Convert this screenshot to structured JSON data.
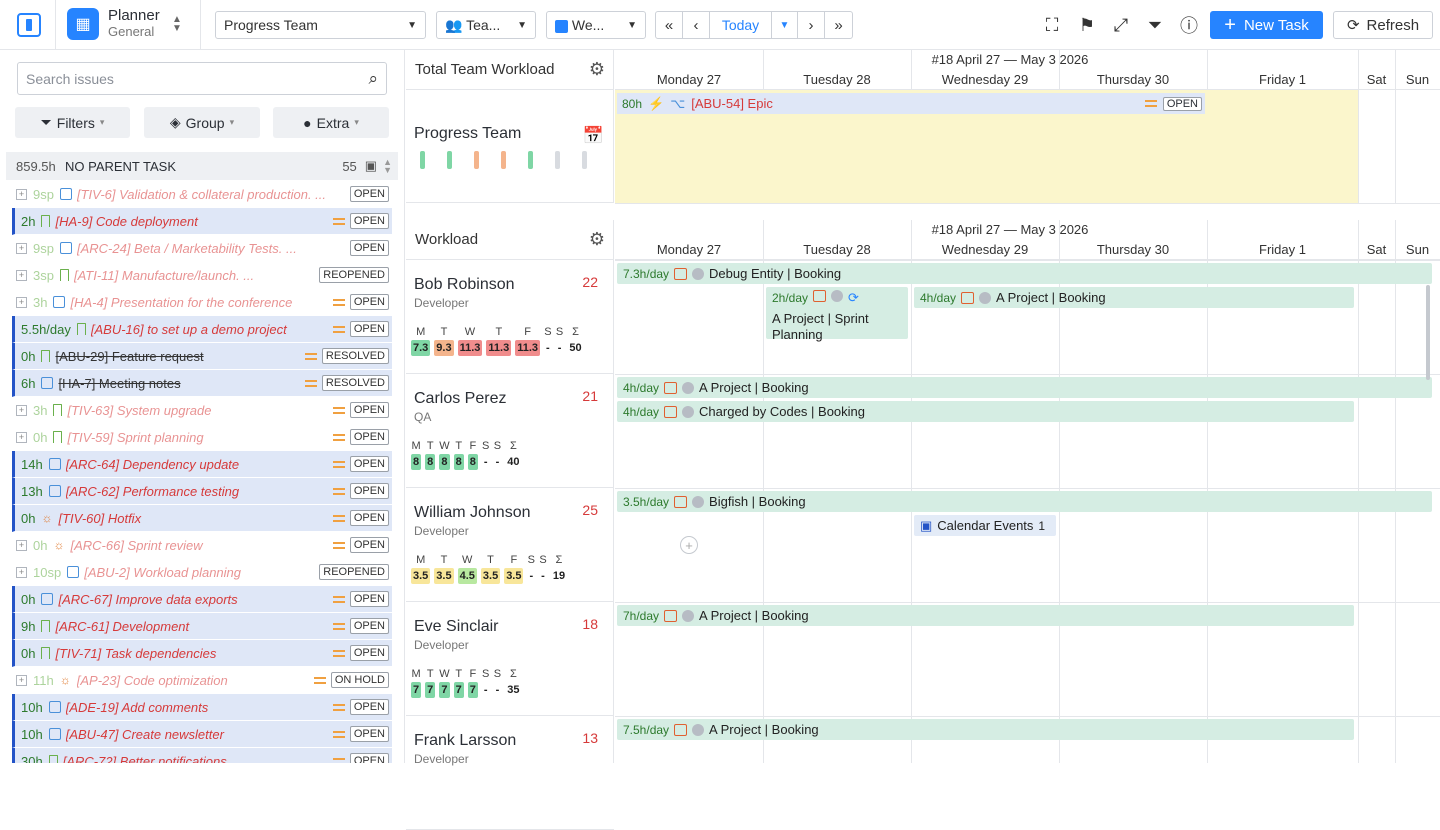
{
  "app": {
    "title": "Planner",
    "subtitle": "General"
  },
  "toolbar": {
    "team_select": "Progress Team",
    "group_select": "Tea...",
    "view_select": "We...",
    "today": "Today",
    "new_task": "New Task",
    "refresh": "Refresh"
  },
  "left": {
    "search_placeholder": "Search issues",
    "filters": "Filters",
    "group": "Group",
    "extra": "Extra",
    "group_header": {
      "hours": "859.5h",
      "label": "NO PARENT TASK",
      "count": "55"
    },
    "rows": [
      {
        "est": "9sp",
        "icon": "check",
        "name": "[TIV-6] Validation & collateral production. ...",
        "status": "OPEN",
        "style": "plain",
        "faded": true,
        "eq": false
      },
      {
        "est": "2h",
        "icon": "bookmark",
        "name": "[HA-9] Code deployment",
        "status": "OPEN",
        "style": "blue",
        "faded": false,
        "eq": true
      },
      {
        "est": "9sp",
        "icon": "check",
        "name": "[ARC-24] Beta / Marketability Tests. ...",
        "status": "OPEN",
        "style": "plain",
        "faded": true,
        "eq": false
      },
      {
        "est": "3sp",
        "icon": "bookmark",
        "name": "[ATI-11] Manufacture/launch. ...",
        "status": "REOPENED",
        "style": "plain",
        "faded": true,
        "eq": false
      },
      {
        "est": "3h",
        "icon": "check",
        "name": "[HA-4] Presentation for the conference",
        "status": "OPEN",
        "style": "plain",
        "faded": true,
        "eq": true
      },
      {
        "est": "5.5h/day",
        "icon": "bookmark",
        "name": "[ABU-16] to set up a demo project",
        "status": "OPEN",
        "style": "blue",
        "faded": false,
        "eq": true
      },
      {
        "est": "0h",
        "icon": "bookmark",
        "name": "[ABU-29] Feature request",
        "status": "RESOLVED",
        "style": "blue",
        "faded": false,
        "eq": true,
        "done": true
      },
      {
        "est": "6h",
        "icon": "check",
        "name": "[HA-7] Meeting notes",
        "status": "RESOLVED",
        "style": "blue",
        "faded": false,
        "eq": true,
        "done": true
      },
      {
        "est": "3h",
        "icon": "bookmark",
        "name": "[TIV-63] System upgrade",
        "status": "OPEN",
        "style": "plain",
        "faded": true,
        "eq": true
      },
      {
        "est": "0h",
        "icon": "bookmark",
        "name": "[TIV-59] Sprint planning",
        "status": "OPEN",
        "style": "plain",
        "faded": true,
        "eq": true
      },
      {
        "est": "14h",
        "icon": "check",
        "name": "[ARC-64] Dependency update",
        "status": "OPEN",
        "style": "blue",
        "faded": false,
        "eq": true
      },
      {
        "est": "13h",
        "icon": "check",
        "name": "[ARC-62] Performance testing",
        "status": "OPEN",
        "style": "blue",
        "faded": false,
        "eq": true
      },
      {
        "est": "0h",
        "icon": "bug",
        "name": "[TIV-60] Hotfix",
        "status": "OPEN",
        "style": "blue",
        "faded": false,
        "eq": true
      },
      {
        "est": "0h",
        "icon": "bug",
        "name": "[ARC-66] Sprint review",
        "status": "OPEN",
        "style": "plain",
        "faded": true,
        "eq": true
      },
      {
        "est": "10sp",
        "icon": "check",
        "name": "[ABU-2] Workload planning",
        "status": "REOPENED",
        "style": "plain",
        "faded": true,
        "eq": false
      },
      {
        "est": "0h",
        "icon": "check",
        "name": "[ARC-67] Improve data exports",
        "status": "OPEN",
        "style": "blue",
        "faded": false,
        "eq": true
      },
      {
        "est": "9h",
        "icon": "bookmark",
        "name": "[ARC-61] Development",
        "status": "OPEN",
        "style": "blue",
        "faded": false,
        "eq": true
      },
      {
        "est": "0h",
        "icon": "bookmark",
        "name": "[TIV-71] Task dependencies",
        "status": "OPEN",
        "style": "blue",
        "faded": false,
        "eq": true
      },
      {
        "est": "11h",
        "icon": "bug",
        "name": "[AP-23] Code optimization",
        "status": "ON HOLD",
        "style": "plain",
        "faded": true,
        "eq": true
      },
      {
        "est": "10h",
        "icon": "check",
        "name": "[ADE-19] Add comments",
        "status": "OPEN",
        "style": "blue",
        "faded": false,
        "eq": true
      },
      {
        "est": "10h",
        "icon": "check",
        "name": "[ABU-47] Create newsletter",
        "status": "OPEN",
        "style": "blue",
        "faded": false,
        "eq": true
      },
      {
        "est": "30h",
        "icon": "bookmark",
        "name": "[ARC-72] Better notifications",
        "status": "OPEN",
        "style": "blue",
        "faded": false,
        "eq": true
      }
    ]
  },
  "center": {
    "team_workload": "Total Team Workload",
    "team_name": "Progress Team",
    "workload": "Workload",
    "people": [
      {
        "name": "Bob Robinson",
        "role": "Developer",
        "count": "22",
        "days": [
          "M",
          "T",
          "W",
          "T",
          "F",
          "S",
          "S",
          "Σ"
        ],
        "vals": [
          "7.3",
          "9.3",
          "11.3",
          "11.3",
          "11.3",
          "-",
          "-",
          "50"
        ],
        "colors": [
          "#7fd6a5",
          "#f4b48c",
          "#f08c8c",
          "#f08c8c",
          "#f08c8c",
          "",
          "",
          ""
        ]
      },
      {
        "name": "Carlos Perez",
        "role": "QA",
        "count": "21",
        "days": [
          "M",
          "T",
          "W",
          "T",
          "F",
          "S",
          "S",
          "Σ"
        ],
        "vals": [
          "8",
          "8",
          "8",
          "8",
          "8",
          "-",
          "-",
          "40"
        ],
        "colors": [
          "#7fd6a5",
          "#7fd6a5",
          "#7fd6a5",
          "#7fd6a5",
          "#7fd6a5",
          "",
          "",
          ""
        ]
      },
      {
        "name": "William Johnson",
        "role": "Developer",
        "count": "25",
        "days": [
          "M",
          "T",
          "W",
          "T",
          "F",
          "S",
          "S",
          "Σ"
        ],
        "vals": [
          "3.5",
          "3.5",
          "4.5",
          "3.5",
          "3.5",
          "-",
          "-",
          "19"
        ],
        "colors": [
          "#f8e69a",
          "#f8e69a",
          "#b8e8a0",
          "#f8e69a",
          "#f8e69a",
          "",
          "",
          ""
        ]
      },
      {
        "name": "Eve Sinclair",
        "role": "Developer",
        "count": "18",
        "days": [
          "M",
          "T",
          "W",
          "T",
          "F",
          "S",
          "S",
          "Σ"
        ],
        "vals": [
          "7",
          "7",
          "7",
          "7",
          "7",
          "-",
          "-",
          "35"
        ],
        "colors": [
          "#7fd6a5",
          "#7fd6a5",
          "#7fd6a5",
          "#7fd6a5",
          "#7fd6a5",
          "",
          "",
          ""
        ]
      },
      {
        "name": "Frank Larsson",
        "role": "Developer",
        "count": "13",
        "days": [],
        "vals": [],
        "colors": []
      }
    ]
  },
  "calendar": {
    "week": "#18 April 27 — May 3 2026",
    "days": [
      "Monday 27",
      "Tuesday 28",
      "Wednesday 29",
      "Thursday 30",
      "Friday 1",
      "Sat",
      "Sun"
    ],
    "epic": {
      "hours": "80h",
      "name": "[ABU-54] Epic",
      "status": "OPEN"
    },
    "bars": [
      {
        "rate": "7.3h/day",
        "label": "Debug Entity | Booking"
      },
      {
        "rate": "2h/day",
        "label": "A Project | Sprint Planning"
      },
      {
        "rate": "4h/day",
        "label": "A Project | Booking"
      },
      {
        "rate": "4h/day",
        "label": "A Project | Booking"
      },
      {
        "rate": "4h/day",
        "label": "Charged by Codes | Booking"
      },
      {
        "rate": "3.5h/day",
        "label": "Bigfish | Booking"
      },
      {
        "rate": "",
        "label": "Calendar Events",
        "count": "1"
      },
      {
        "rate": "7h/day",
        "label": "A Project | Booking"
      },
      {
        "rate": "7.5h/day",
        "label": "A Project | Booking"
      }
    ]
  },
  "colors": {
    "accent": "#2684ff",
    "epic_bg": "#fbf6cc",
    "bar_bg": "#d5ede3",
    "row_blue": "#dfe7f7"
  }
}
